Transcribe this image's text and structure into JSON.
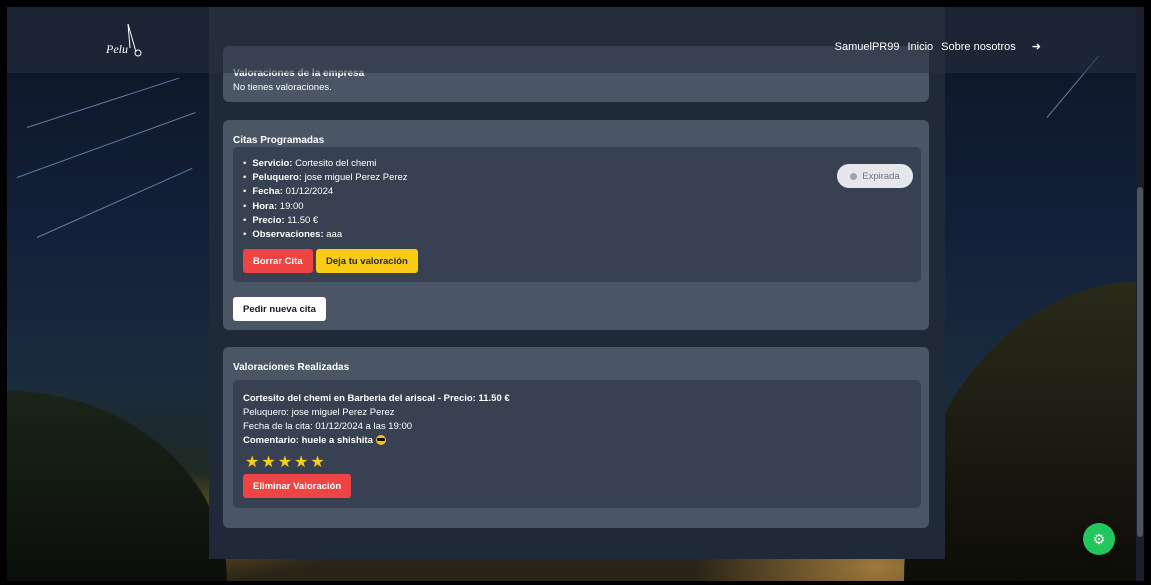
{
  "app": {
    "logo_text": "Pelu"
  },
  "navbar": {
    "username": "SamuelPR99",
    "home_label": "Inicio",
    "about_label": "Sobre nosotros"
  },
  "valoraciones_empresa": {
    "title": "Valoraciones de la empresa",
    "empty_text": "No tienes valoraciones."
  },
  "citas": {
    "title": "Citas Programadas",
    "appointment": {
      "fields": [
        {
          "label": "Servicio:",
          "value": "Cortesito del chemi"
        },
        {
          "label": "Peluquero:",
          "value": "jose miguel Perez Perez"
        },
        {
          "label": "Fecha:",
          "value": "01/12/2024"
        },
        {
          "label": "Hora:",
          "value": "19:00"
        },
        {
          "label": "Precio:",
          "value": "11.50 €"
        },
        {
          "label": "Observaciones:",
          "value": "aaa"
        }
      ],
      "status": "Expirada",
      "delete_label": "Borrar Cita",
      "review_label": "Deja tu valoración"
    },
    "new_appointment_label": "Pedir nueva cita"
  },
  "valoraciones_realizadas": {
    "title": "Valoraciones Realizadas",
    "review": {
      "headline": "Cortesito del chemi en Barberia del ariscal - Precio: 11.50 €",
      "barber": "Peluquero: jose miguel Perez Perez",
      "date": "Fecha de la cita: 01/12/2024 a las 19:00",
      "comment": "Comentario: huele a shishita",
      "rating": 5,
      "stars_text": "★★★★★",
      "delete_label": "Eliminar Valoración"
    }
  },
  "colors": {
    "danger": "#ef4444",
    "warning": "#facc15",
    "success": "#22c55e",
    "card": "#4a5566",
    "inner": "#374151"
  }
}
